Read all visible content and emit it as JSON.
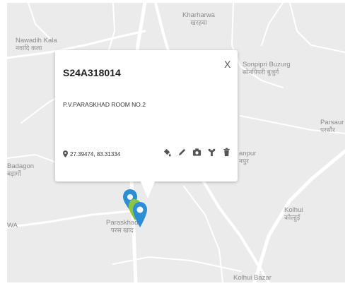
{
  "map": {
    "places": [
      {
        "name": "Kharharwa",
        "local": "खरहवा"
      },
      {
        "name": "Nawadih Kala",
        "local": "नवादि कला"
      },
      {
        "name": "Sonpipri Buzurg",
        "local": "सोनपिपरी बुजुर्ग"
      },
      {
        "name": "Parsaur",
        "local": "परसौर"
      },
      {
        "name": "Badagon",
        "local": "बड़ागों"
      },
      {
        "name": "anpur",
        "local": "नपुर"
      },
      {
        "name": "WA",
        "local": ""
      },
      {
        "name": "Paraskhad",
        "local": "परस खाद"
      },
      {
        "name": "Kolhui",
        "local": "कोल्हुई"
      },
      {
        "name": "Kolhui Bazar",
        "local": ""
      }
    ]
  },
  "popup": {
    "title": "S24A318014",
    "close_label": "X",
    "address": "P.V.PARASKHAD ROOM NO.2",
    "coordinates": "27.39474, 83.31334",
    "tools": [
      "paint-bucket-icon",
      "pencil-icon",
      "camera-icon",
      "tools-icon",
      "trash-icon"
    ]
  },
  "colors": {
    "marker_blue": "#2c8fd6",
    "marker_green": "#8cc63f",
    "map_background": "#ebebeb",
    "road": "#ffffff"
  }
}
